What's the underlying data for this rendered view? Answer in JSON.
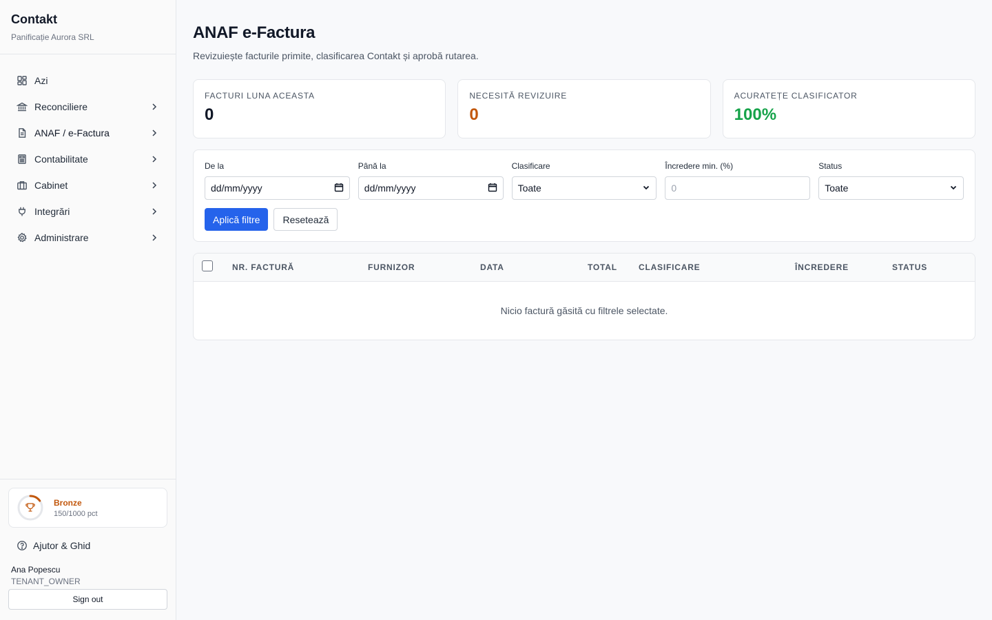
{
  "brand": {
    "name": "Contakt",
    "company": "Panificație Aurora SRL"
  },
  "nav": [
    {
      "label": "Azi",
      "icon": "dashboard-icon",
      "chevron": false
    },
    {
      "label": "Reconciliere",
      "icon": "bank-icon",
      "chevron": true
    },
    {
      "label": "ANAF / e-Factura",
      "icon": "document-icon",
      "chevron": true,
      "active": true
    },
    {
      "label": "Contabilitate",
      "icon": "calculator-icon",
      "chevron": true
    },
    {
      "label": "Cabinet",
      "icon": "briefcase-icon",
      "chevron": true
    },
    {
      "label": "Integrări",
      "icon": "plug-icon",
      "chevron": true
    },
    {
      "label": "Administrare",
      "icon": "gear-icon",
      "chevron": true
    }
  ],
  "tier": {
    "name": "Bronze",
    "points": "150/1000 pct",
    "progress": 0.15,
    "color": "#c2570c"
  },
  "help": {
    "label": "Ajutor & Ghid"
  },
  "user": {
    "name": "Ana Popescu",
    "role": "TENANT_OWNER",
    "signout": "Sign out"
  },
  "page": {
    "title": "ANAF e-Factura",
    "subtitle": "Revizuiește facturile primite, clasificarea Contakt și aprobă rutarea."
  },
  "stats": [
    {
      "label": "FACTURI LUNA ACEASTA",
      "value": "0",
      "color": "#111827"
    },
    {
      "label": "NECESITĂ REVIZUIRE",
      "value": "0",
      "color": "#c2570c"
    },
    {
      "label": "ACURATEȚE CLASIFICATOR",
      "value": "100%",
      "color": "#16a34a"
    }
  ],
  "filters": {
    "from": {
      "label": "De la",
      "value": "dd/mm/yyyy"
    },
    "to": {
      "label": "Până la",
      "value": "dd/mm/yyyy"
    },
    "classification": {
      "label": "Clasificare",
      "value": "Toate"
    },
    "confidence": {
      "label": "Încredere min. (%)",
      "placeholder": "0"
    },
    "status": {
      "label": "Status",
      "value": "Toate"
    },
    "apply": "Aplică filtre",
    "reset": "Resetează"
  },
  "table": {
    "columns": [
      "NR. FACTURĂ",
      "FURNIZOR",
      "DATA",
      "TOTAL",
      "CLASIFICARE",
      "ÎNCREDERE",
      "STATUS"
    ],
    "empty": "Nicio factură găsită cu filtrele selectate."
  },
  "colors": {
    "primary": "#2563eb",
    "warning": "#c2570c",
    "success": "#16a34a"
  }
}
